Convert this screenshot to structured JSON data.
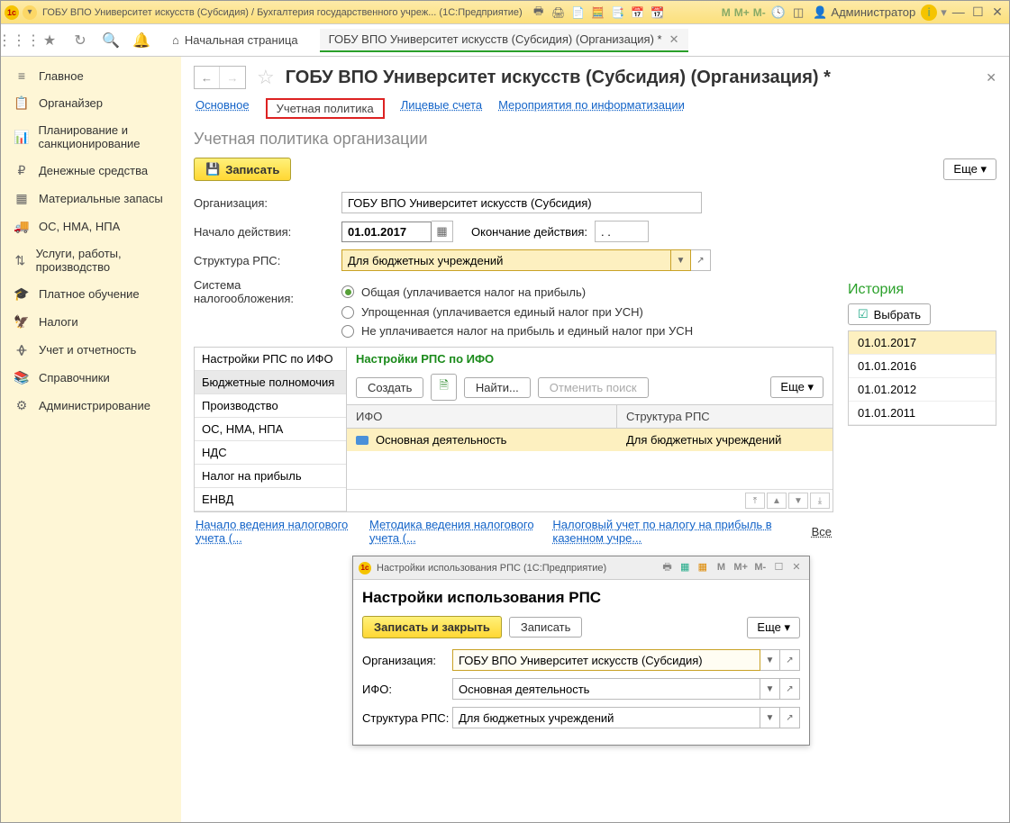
{
  "titlebar": {
    "title": "ГОБУ ВПО Университет искусств (Субсидия) / Бухгалтерия государственного учреж...  (1С:Предприятие)",
    "m1": "М",
    "m2": "М+",
    "m3": "М-",
    "user": "Администратор"
  },
  "topnav": {
    "start": "Начальная страница",
    "tab": "ГОБУ ВПО Университет искусств (Субсидия) (Организация) *"
  },
  "sidebar": [
    {
      "icon": "≡",
      "label": "Главное"
    },
    {
      "icon": "📋",
      "label": "Органайзер"
    },
    {
      "icon": "📊",
      "label": "Планирование и санкционирование"
    },
    {
      "icon": "₽",
      "label": "Денежные средства"
    },
    {
      "icon": "▦",
      "label": "Материальные запасы"
    },
    {
      "icon": "🚚",
      "label": "ОС, НМА, НПА"
    },
    {
      "icon": "⇅",
      "label": "Услуги, работы, производство"
    },
    {
      "icon": "🎓",
      "label": "Платное обучение"
    },
    {
      "icon": "🦅",
      "label": "Налоги"
    },
    {
      "icon": "ᚖ",
      "label": "Учет и отчетность"
    },
    {
      "icon": "📚",
      "label": "Справочники"
    },
    {
      "icon": "⚙",
      "label": "Администрирование"
    }
  ],
  "page": {
    "title": "ГОБУ ВПО Университет искусств (Субсидия) (Организация) *",
    "tabs": {
      "main": "Основное",
      "policy": "Учетная политика",
      "accounts": "Лицевые счета",
      "events": "Мероприятия по информатизации"
    },
    "section": "Учетная политика организации",
    "write": "Записать",
    "more": "Еще ▾"
  },
  "form": {
    "org_lbl": "Организация:",
    "org_val": "ГОБУ ВПО Университет искусств (Субсидия)",
    "start_lbl": "Начало действия:",
    "start_val": "01.01.2017",
    "end_lbl": "Окончание действия:",
    "end_val": "  .  .",
    "rps_lbl": "Структура РПС:",
    "rps_val": "Для бюджетных учреждений",
    "tax_lbl": "Система налогообложения:",
    "tax_opts": [
      "Общая (уплачивается налог на прибыль)",
      "Упрощенная (уплачивается единый налог при УСН)",
      "Не уплачивается налог на прибыль и единый налог при УСН"
    ]
  },
  "leftlist": [
    "Настройки РПС по ИФО",
    "Бюджетные полномочия",
    "Производство",
    "ОС, НМА, НПА",
    "НДС",
    "Налог на прибыль",
    "ЕНВД"
  ],
  "rightpanel": {
    "title": "Настройки РПС по ИФО",
    "create": "Создать",
    "find": "Найти...",
    "cancel": "Отменить поиск",
    "more": "Еще ▾",
    "col1": "ИФО",
    "col2": "Структура РПС",
    "row1": "Основная деятельность",
    "row2": "Для бюджетных учреждений"
  },
  "history": {
    "title": "История",
    "select": "Выбрать",
    "items": [
      "01.01.2017",
      "01.01.2016",
      "01.01.2012",
      "01.01.2011"
    ]
  },
  "dialog": {
    "wtitle": "Настройки использования РПС  (1С:Предприятие)",
    "title": "Настройки использования РПС",
    "save_close": "Записать и закрыть",
    "save": "Записать",
    "more": "Еще ▾",
    "org_lbl": "Организация:",
    "org_val": "ГОБУ ВПО Университет искусств (Субсидия)",
    "ifo_lbl": "ИФО:",
    "ifo_val": "Основная деятельность",
    "rps_lbl": "Структура РПС:",
    "rps_val": "Для бюджетных учреждений"
  },
  "footer": {
    "l1": "Начало ведения налогового учета (...",
    "l2": "Методика ведения налогового учета (...",
    "l3": "Налоговый учет по налогу на прибыль в казенном учре...",
    "all": "Все"
  }
}
